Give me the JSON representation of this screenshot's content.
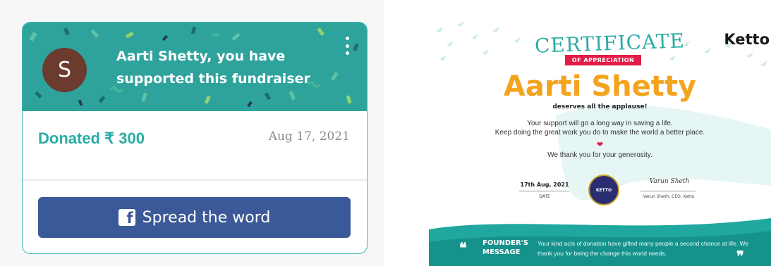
{
  "donation_card": {
    "avatar_initial": "S",
    "support_message": "Aarti Shetty, you have supported this fundraiser",
    "donated_label": "Donated ₹ 300",
    "date": "Aug 17, 2021",
    "share_button_label": "Spread the word",
    "share_icon": "facebook-icon",
    "menu_icon": "kebab-menu-icon"
  },
  "certificate": {
    "logo": "Ketto",
    "title": "CERTIFICATE",
    "subtitle": "OF APPRECIATION",
    "recipient": "Aarti Shetty",
    "applause": "deserves all the applause!",
    "message_line1": "Your support will go a long way in saving a life.",
    "message_line2": "Keep doing the great work you do to make the world a better place.",
    "thanks": "We thank you for your generosity.",
    "date_value": "17th Aug, 2021",
    "date_label": "DATE",
    "seal_text": "KETTO",
    "signature": "Varun Sheth",
    "signer": "Varun Sheth, CEO, Ketto",
    "founders_label": "FOUNDER'S MESSAGE",
    "founders_message": "Your kind acts of donation have gifted many people a second chance at life. We thank you for being the change this world needs.",
    "quote_open": "❝",
    "quote_close": "❞"
  },
  "colors": {
    "teal": "#2ea39c",
    "facebook_blue": "#3b5998",
    "certificate_gold": "#f4a31c",
    "banner_red": "#e11d48"
  }
}
